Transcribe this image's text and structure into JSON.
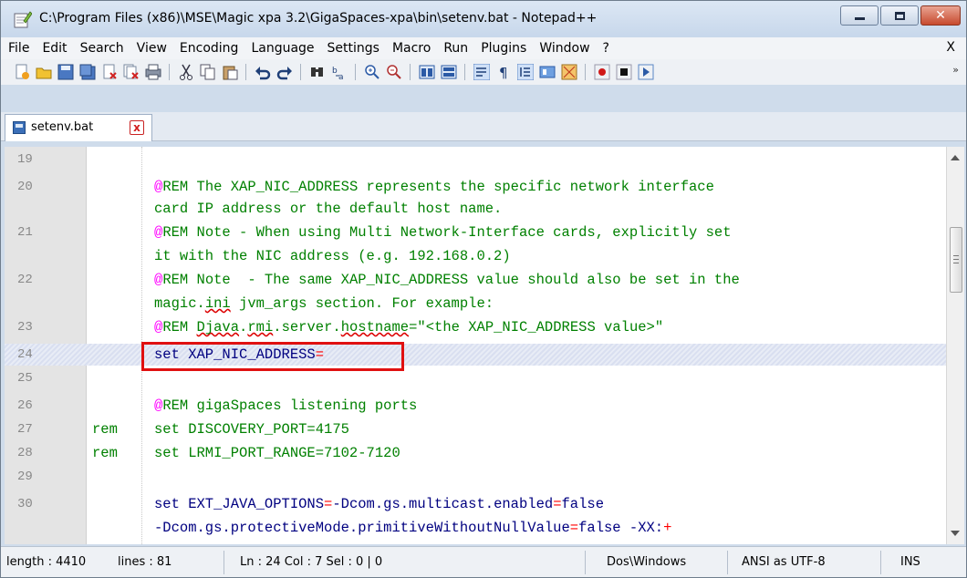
{
  "window": {
    "title": "C:\\Program Files (x86)\\MSE\\Magic xpa 3.2\\GigaSpaces-xpa\\bin\\setenv.bat - Notepad++",
    "close_glyph": "✕"
  },
  "menu": {
    "items": [
      "File",
      "Edit",
      "Search",
      "View",
      "Encoding",
      "Language",
      "Settings",
      "Macro",
      "Run",
      "Plugins",
      "Window",
      "?"
    ],
    "close_label": "X"
  },
  "toolbar": {
    "icons": [
      "new-file-icon",
      "open-file-icon",
      "save-icon",
      "save-all-icon",
      "close-icon",
      "close-all-icon",
      "print-icon",
      "cut-icon",
      "copy-icon",
      "paste-icon",
      "undo-icon",
      "redo-icon",
      "find-icon",
      "replace-icon",
      "zoom-in-icon",
      "zoom-out-icon",
      "sync-vertical-icon",
      "sync-horizontal-icon",
      "word-wrap-icon",
      "show-all-chars-icon",
      "indent-guide-icon",
      "user-lang-icon",
      "doc-map-icon",
      "record-macro-icon",
      "stop-macro-icon",
      "play-macro-icon"
    ],
    "overflow": "»"
  },
  "tab": {
    "label": "setenv.bat",
    "close_glyph": "x"
  },
  "editor": {
    "lines": {
      "l19": "19",
      "l20": "20",
      "l20_text": "REM The XAP_NIC_ADDRESS represents the specific network interface",
      "l20_cont": "card IP address or the default host name.",
      "l21": "21",
      "l21_text": "REM Note - When using Multi Network-Interface cards, explicitly set",
      "l21_cont": "it with the NIC address (e.g. 192.168.0.2)",
      "l22": "22",
      "l22_text": "REM Note  - The same XAP_NIC_ADDRESS value should also be set in the",
      "l22_cont_a": "magic.",
      "l22_cont_b": "ini",
      "l22_cont_c": " jvm_args section. For example:",
      "l23": "23",
      "l23_text_a": "REM ",
      "l23_text_b": "Djava",
      "l23_text_c": ".",
      "l23_text_d": "rmi",
      "l23_text_e": ".server.",
      "l23_text_f": "hostname",
      "l23_text_g": "=\"<the XAP_NIC_ADDRESS value>\"",
      "l24": "24",
      "l24_text": "set XAP_NIC_ADDRESS",
      "l24_eq": "=",
      "l25": "25",
      "l26": "26",
      "l26_text": "REM gigaSpaces listening ports",
      "l27": "27",
      "l27_rem": "rem",
      "l27_text": "set DISCOVERY_PORT=4175",
      "l28": "28",
      "l28_rem": "rem",
      "l28_text": "set LRMI_PORT_RANGE=7102-7120",
      "l29": "29",
      "l30": "30",
      "l30_text_a": "set EXT_JAVA_OPTIONS",
      "l30_text_b": "=",
      "l30_text_c": "-Dcom.gs.multicast.enabled",
      "l30_text_d": "=",
      "l30_text_e": "false",
      "l30_cont_a": "-Dcom.gs.protectiveMode.primitiveWithoutNullValue",
      "l30_cont_b": "=",
      "l30_cont_c": "false -XX:",
      "l30_cont_d": "+"
    },
    "at_sign": "@"
  },
  "status": {
    "length": "length : 4410",
    "lines": "lines : 81",
    "position": "Ln : 24   Col : 7   Sel : 0 | 0",
    "eol": "Dos\\Windows",
    "encoding": "ANSI as UTF-8",
    "mode": "INS"
  },
  "colors": {
    "comment": "#008000",
    "at_sign": "#ff00ff",
    "keyword": "#000080",
    "operator": "#ff0000",
    "highlight_box": "#e01010"
  }
}
